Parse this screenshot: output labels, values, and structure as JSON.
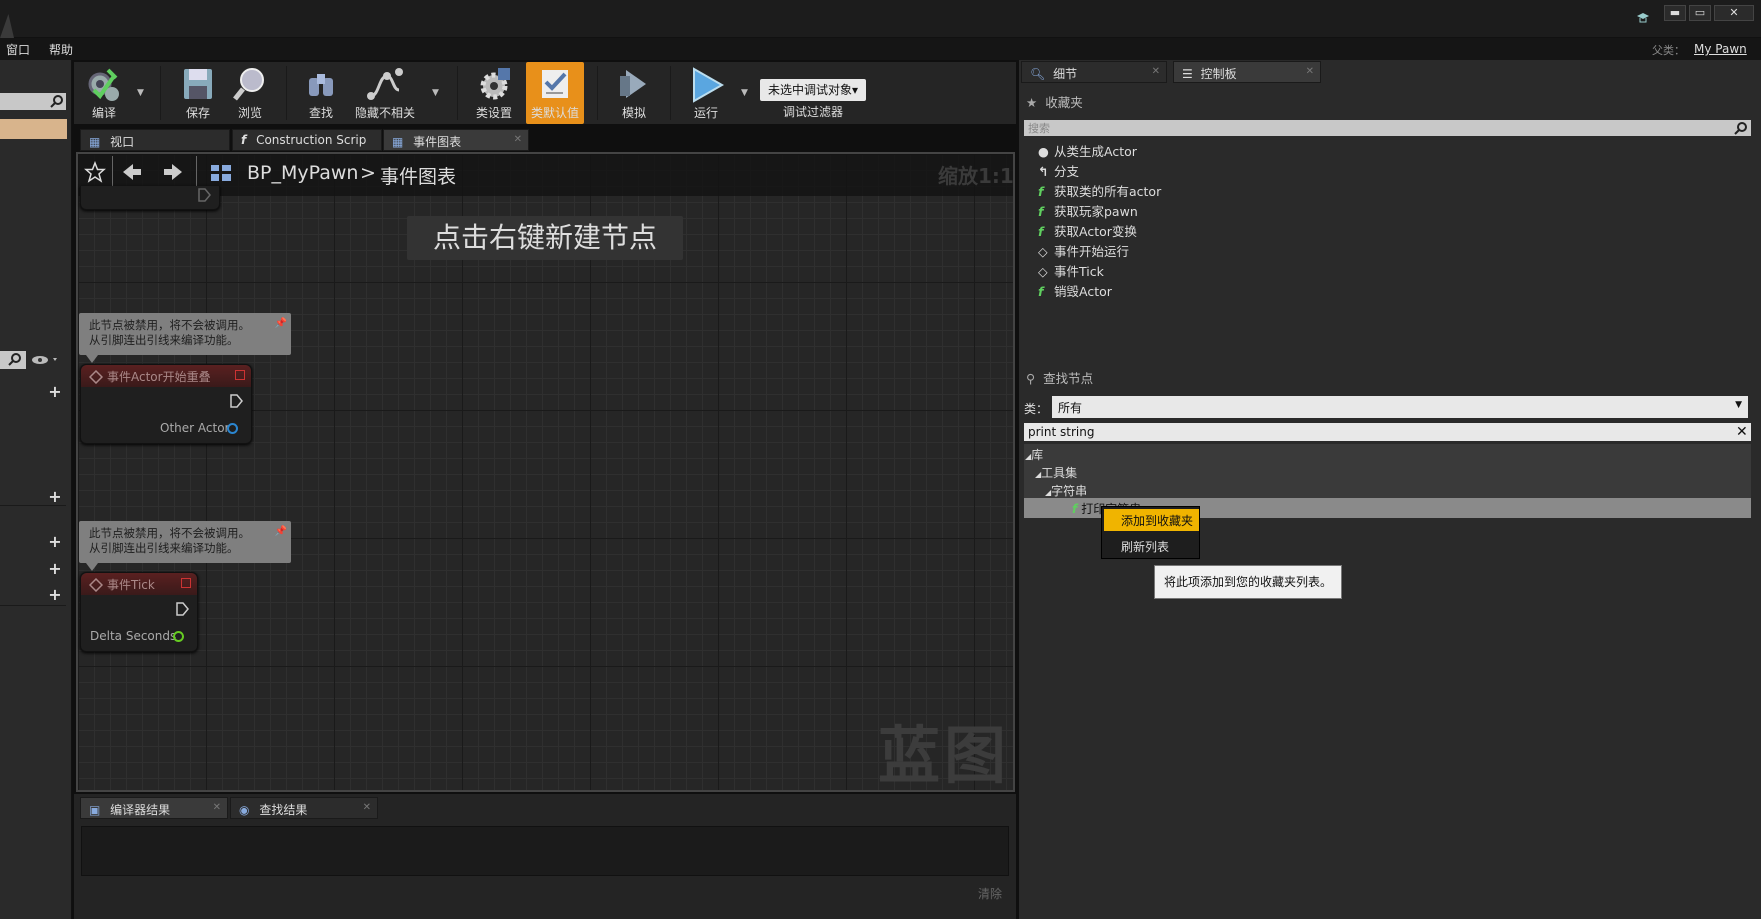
{
  "menu": {
    "window": "窗口",
    "help": "帮助"
  },
  "parent_class": {
    "label": "父类：",
    "value": "My Pawn"
  },
  "window_controls": {
    "minimize": "▬",
    "maximize": "▭",
    "close": "✕"
  },
  "toolbar": {
    "compile": "编译",
    "save": "保存",
    "browse": "浏览",
    "find": "查找",
    "hide_unrelated": "隐藏不相关",
    "class_settings": "类设置",
    "class_defaults": "类默认值",
    "simulate": "模拟",
    "play": "运行",
    "debug_object": "未选中调试对象▾",
    "debug_filter": "调试过滤器"
  },
  "editor_tabs": [
    {
      "label": "视口"
    },
    {
      "label": "Construction Scrip"
    },
    {
      "label": "事件图表"
    }
  ],
  "graph": {
    "breadcrumb_root": "BP_MyPawn",
    "breadcrumb_sep": ">",
    "breadcrumb_current": "事件图表",
    "zoom": "缩放1:1",
    "hint": "点击右键新建节点",
    "watermark": "蓝图",
    "comments": [
      {
        "line1": "此节点被禁用，将不会被调用。",
        "line2": "从引脚连出引线来编译功能。"
      },
      {
        "line1": "此节点被禁用，将不会被调用。",
        "line2": "从引脚连出引线来编译功能。"
      }
    ],
    "nodes": [
      {
        "title": "事件Actor开始重叠",
        "pin": "Other Actor"
      },
      {
        "title": "事件Tick",
        "pin": "Delta Seconds"
      }
    ]
  },
  "bottom_tabs": [
    {
      "label": "编译器结果"
    },
    {
      "label": "查找结果"
    }
  ],
  "bottom_clear": "清除",
  "right_tabs": [
    {
      "label": "细节"
    },
    {
      "label": "控制板"
    }
  ],
  "favorites": {
    "title": "收藏夹",
    "search_placeholder": "搜索",
    "items": [
      {
        "label": "从类生成Actor",
        "icon": "spawn-icon"
      },
      {
        "label": "分支",
        "icon": "branch-icon"
      },
      {
        "label": "获取类的所有actor",
        "icon": "function-icon"
      },
      {
        "label": "获取玩家pawn",
        "icon": "function-icon"
      },
      {
        "label": "获取Actor变换",
        "icon": "function-icon"
      },
      {
        "label": "事件开始运行",
        "icon": "event-icon"
      },
      {
        "label": "事件Tick",
        "icon": "event-icon"
      },
      {
        "label": "销毁Actor",
        "icon": "function-icon"
      }
    ]
  },
  "find_nodes": {
    "title": "查找节点",
    "class_label": "类：",
    "class_value": "所有",
    "search_value": "print string",
    "tree": [
      {
        "label": "库",
        "level": 0
      },
      {
        "label": "工具集",
        "level": 1
      },
      {
        "label": "字符串",
        "level": 2
      },
      {
        "label": "打印字符串",
        "level": 3
      }
    ]
  },
  "context_menu": {
    "items": [
      {
        "label": "添加到收藏夹"
      },
      {
        "label": "刷新列表"
      }
    ]
  },
  "tooltip": "将此项添加到您的收藏夹列表。",
  "colors": {
    "accent": "#f0b400",
    "function": "#5fcf5f",
    "node_header": "#5a2020"
  }
}
